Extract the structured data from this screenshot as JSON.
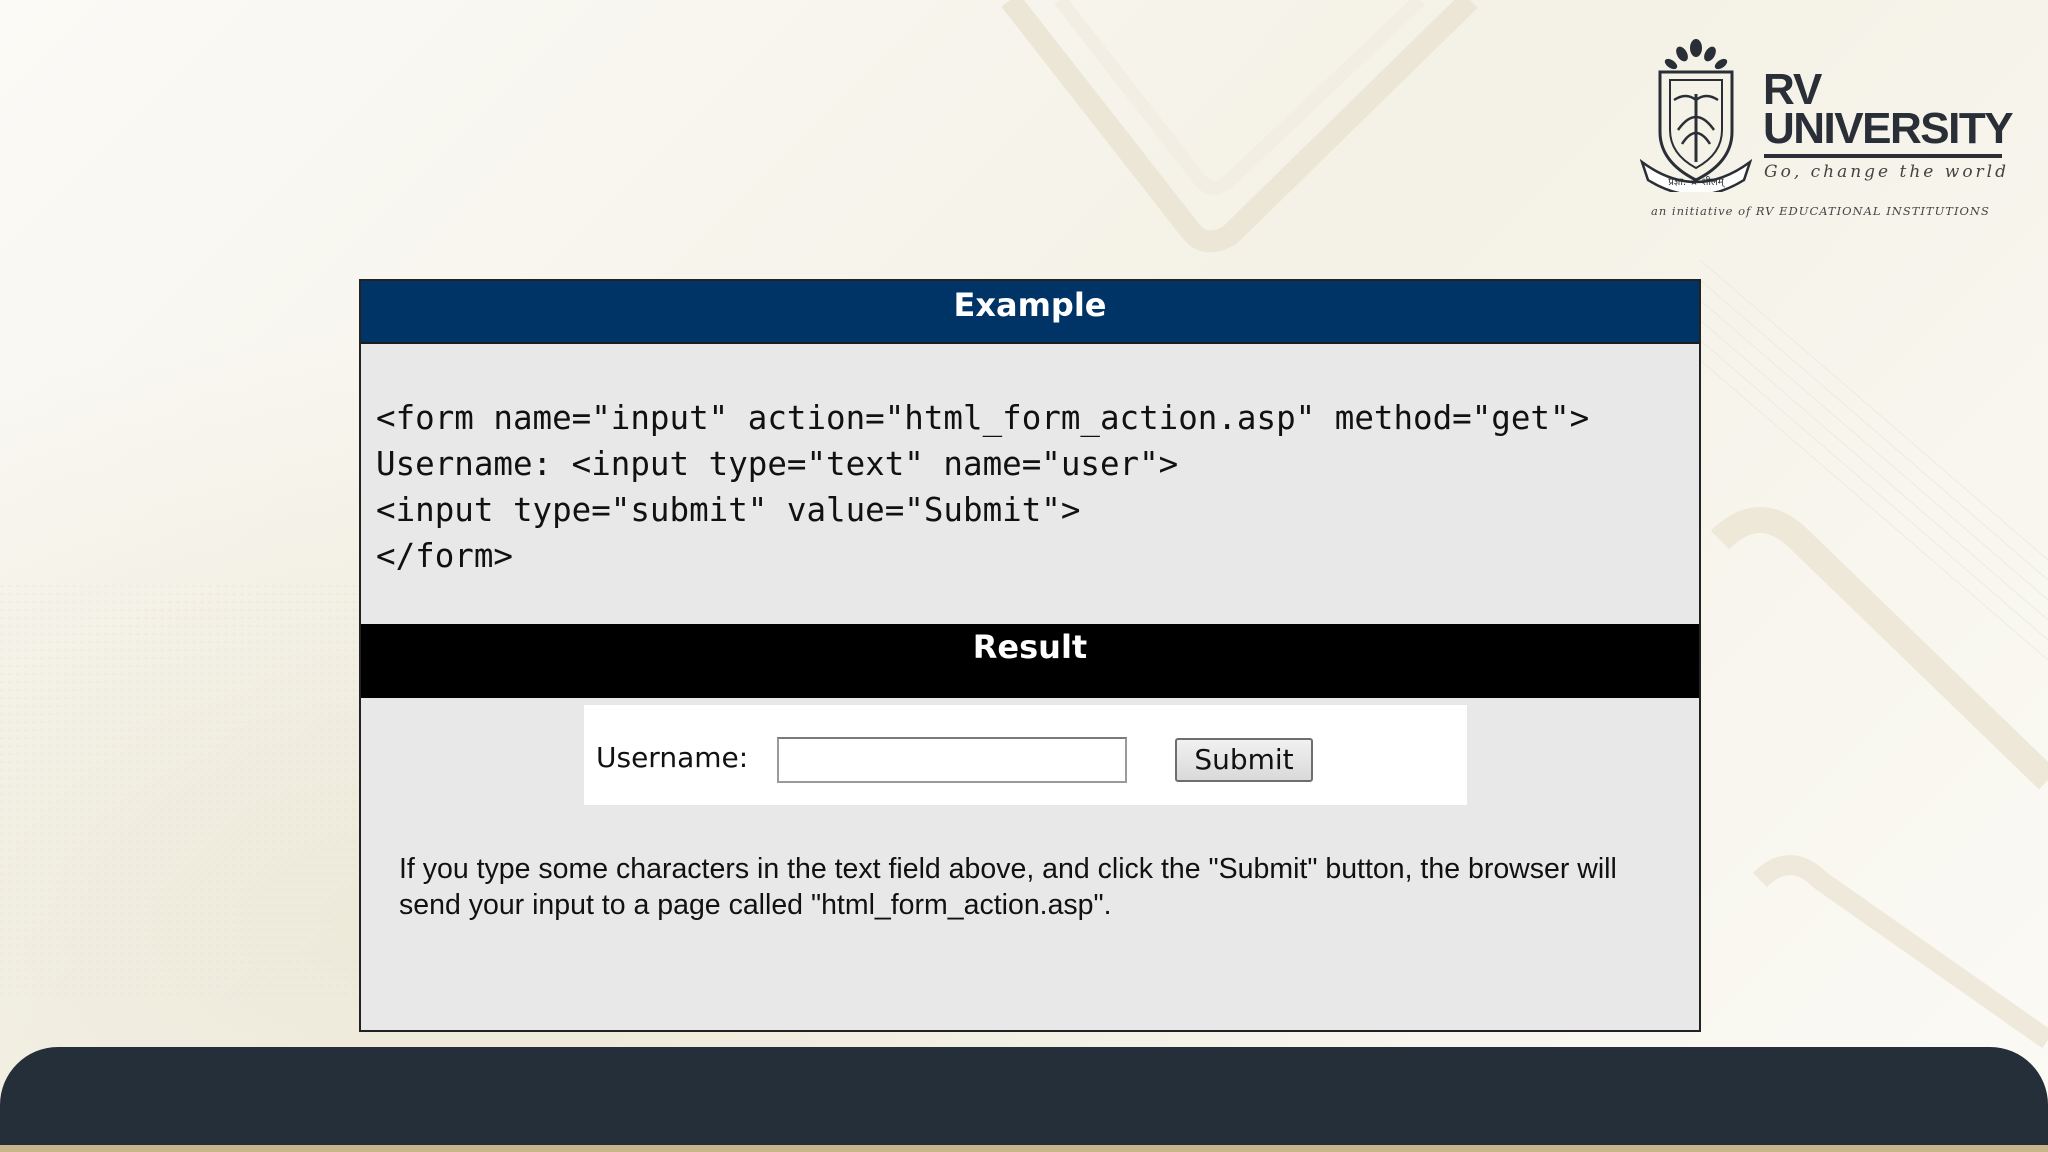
{
  "logo": {
    "name_line1": "RV",
    "name_line2": "UNIVERSITY",
    "tagline": "Go, change the world",
    "initiative": "an initiative of RV EDUCATIONAL INSTITUTIONS",
    "crest_icon": "rv-university-crest-icon",
    "crest_motto": "प्रज्ञा: ★ शीलम्",
    "color": "#2a2e36"
  },
  "example": {
    "title": "Example",
    "bar_color": "#003366",
    "code": "<form name=\"input\" action=\"html_form_action.asp\" method=\"get\">\nUsername: <input type=\"text\" name=\"user\">\n<input type=\"submit\" value=\"Submit\">\n</form>"
  },
  "result": {
    "title": "Result",
    "bar_color": "#000000",
    "label": "Username:",
    "input_value": "",
    "submit_label": "Submit",
    "note": "If you type some characters in the text field above, and click the \"Submit\" button, the browser will send your input to a page called \"html_form_action.asp\"."
  },
  "footer": {
    "bar_color": "#252f3a",
    "strip_color": "#c8b68a"
  }
}
